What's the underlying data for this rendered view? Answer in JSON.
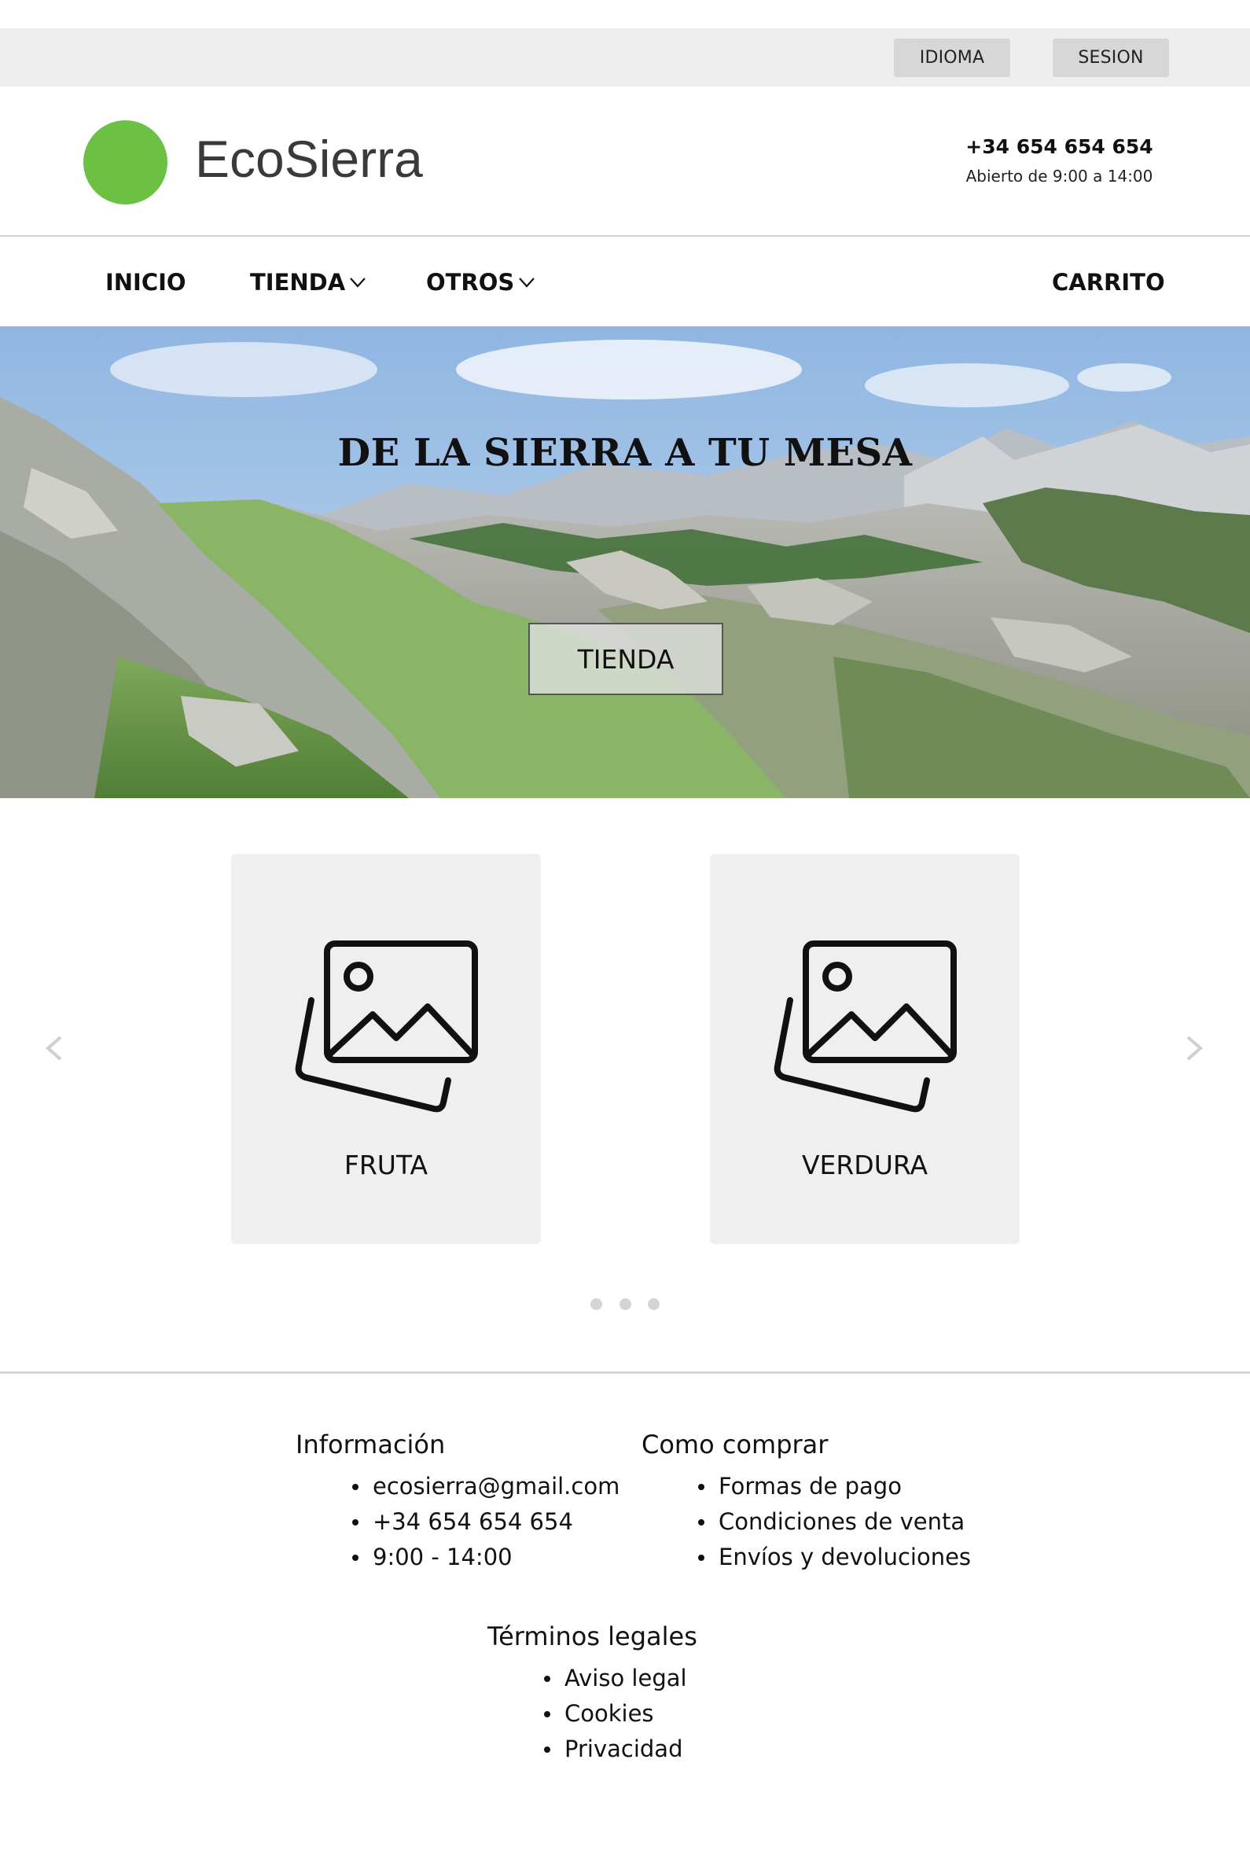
{
  "topbar": {
    "language_label": "IDIOMA",
    "session_label": "SESION"
  },
  "header": {
    "brand": "EcoSierra",
    "phone": "+34 654 654 654",
    "hours": "Abierto de 9:00 a 14:00",
    "logo_color": "#6cc043"
  },
  "nav": {
    "home": "INICIO",
    "shop": "TIENDA",
    "others": "OTROS",
    "cart": "CARRITO"
  },
  "hero": {
    "title": "DE LA SIERRA A TU MESA",
    "button": "TIENDA"
  },
  "carousel": {
    "prev_icon": "chevron-left-icon",
    "next_icon": "chevron-right-icon",
    "cards": [
      {
        "label": "FRUTA",
        "icon": "images-icon"
      },
      {
        "label": "VERDURA",
        "icon": "images-icon"
      }
    ],
    "dot_count": 3
  },
  "footer": {
    "info": {
      "title": "Información",
      "items": [
        "ecosierra@gmail.com",
        "+34 654 654 654",
        "9:00 - 14:00"
      ]
    },
    "buy": {
      "title": "Como comprar",
      "items": [
        "Formas de pago",
        "Condiciones de venta",
        "Envíos y devoluciones"
      ]
    },
    "legal": {
      "title": "Términos legales",
      "items": [
        "Aviso legal",
        "Cookies",
        "Privacidad"
      ]
    }
  }
}
